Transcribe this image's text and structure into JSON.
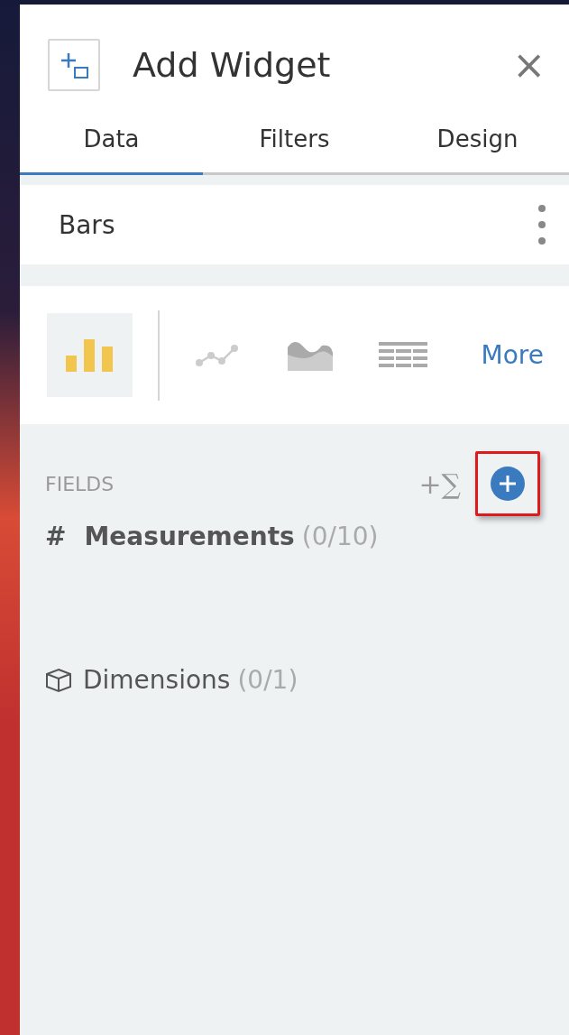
{
  "header": {
    "title": "Add Widget",
    "close_glyph": "×"
  },
  "tabs": [
    {
      "label": "Data",
      "selected": true
    },
    {
      "label": "Filters",
      "selected": false
    },
    {
      "label": "Design",
      "selected": false
    }
  ],
  "widget": {
    "name": "Bars"
  },
  "chart_types": [
    {
      "kind": "bar",
      "selected": true
    },
    {
      "kind": "line",
      "selected": false
    },
    {
      "kind": "area",
      "selected": false
    },
    {
      "kind": "table",
      "selected": false
    }
  ],
  "more_link": "More",
  "fields": {
    "heading": "FIELDS",
    "formula_glyph": "+∑",
    "groups": [
      {
        "kind": "measure",
        "glyph": "#",
        "label": "Measurements",
        "count": "(0/10)"
      },
      {
        "kind": "dimension",
        "label": "Dimensions",
        "count": "(0/1)"
      }
    ]
  }
}
